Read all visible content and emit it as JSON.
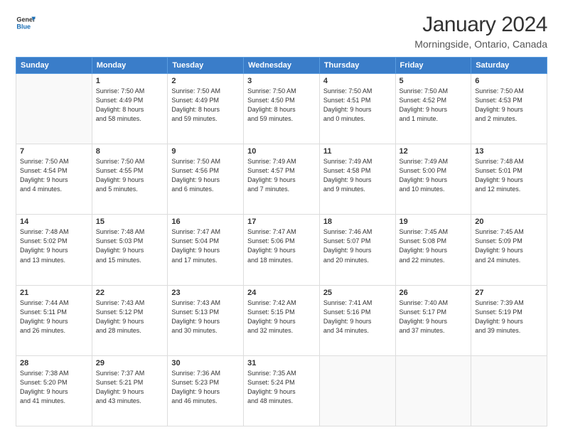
{
  "logo": {
    "line1": "General",
    "line2": "Blue"
  },
  "title": "January 2024",
  "subtitle": "Morningside, Ontario, Canada",
  "weekdays": [
    "Sunday",
    "Monday",
    "Tuesday",
    "Wednesday",
    "Thursday",
    "Friday",
    "Saturday"
  ],
  "weeks": [
    [
      {
        "day": "",
        "info": ""
      },
      {
        "day": "1",
        "info": "Sunrise: 7:50 AM\nSunset: 4:49 PM\nDaylight: 8 hours\nand 58 minutes."
      },
      {
        "day": "2",
        "info": "Sunrise: 7:50 AM\nSunset: 4:49 PM\nDaylight: 8 hours\nand 59 minutes."
      },
      {
        "day": "3",
        "info": "Sunrise: 7:50 AM\nSunset: 4:50 PM\nDaylight: 8 hours\nand 59 minutes."
      },
      {
        "day": "4",
        "info": "Sunrise: 7:50 AM\nSunset: 4:51 PM\nDaylight: 9 hours\nand 0 minutes."
      },
      {
        "day": "5",
        "info": "Sunrise: 7:50 AM\nSunset: 4:52 PM\nDaylight: 9 hours\nand 1 minute."
      },
      {
        "day": "6",
        "info": "Sunrise: 7:50 AM\nSunset: 4:53 PM\nDaylight: 9 hours\nand 2 minutes."
      }
    ],
    [
      {
        "day": "7",
        "info": "Sunrise: 7:50 AM\nSunset: 4:54 PM\nDaylight: 9 hours\nand 4 minutes."
      },
      {
        "day": "8",
        "info": "Sunrise: 7:50 AM\nSunset: 4:55 PM\nDaylight: 9 hours\nand 5 minutes."
      },
      {
        "day": "9",
        "info": "Sunrise: 7:50 AM\nSunset: 4:56 PM\nDaylight: 9 hours\nand 6 minutes."
      },
      {
        "day": "10",
        "info": "Sunrise: 7:49 AM\nSunset: 4:57 PM\nDaylight: 9 hours\nand 7 minutes."
      },
      {
        "day": "11",
        "info": "Sunrise: 7:49 AM\nSunset: 4:58 PM\nDaylight: 9 hours\nand 9 minutes."
      },
      {
        "day": "12",
        "info": "Sunrise: 7:49 AM\nSunset: 5:00 PM\nDaylight: 9 hours\nand 10 minutes."
      },
      {
        "day": "13",
        "info": "Sunrise: 7:48 AM\nSunset: 5:01 PM\nDaylight: 9 hours\nand 12 minutes."
      }
    ],
    [
      {
        "day": "14",
        "info": "Sunrise: 7:48 AM\nSunset: 5:02 PM\nDaylight: 9 hours\nand 13 minutes."
      },
      {
        "day": "15",
        "info": "Sunrise: 7:48 AM\nSunset: 5:03 PM\nDaylight: 9 hours\nand 15 minutes."
      },
      {
        "day": "16",
        "info": "Sunrise: 7:47 AM\nSunset: 5:04 PM\nDaylight: 9 hours\nand 17 minutes."
      },
      {
        "day": "17",
        "info": "Sunrise: 7:47 AM\nSunset: 5:06 PM\nDaylight: 9 hours\nand 18 minutes."
      },
      {
        "day": "18",
        "info": "Sunrise: 7:46 AM\nSunset: 5:07 PM\nDaylight: 9 hours\nand 20 minutes."
      },
      {
        "day": "19",
        "info": "Sunrise: 7:45 AM\nSunset: 5:08 PM\nDaylight: 9 hours\nand 22 minutes."
      },
      {
        "day": "20",
        "info": "Sunrise: 7:45 AM\nSunset: 5:09 PM\nDaylight: 9 hours\nand 24 minutes."
      }
    ],
    [
      {
        "day": "21",
        "info": "Sunrise: 7:44 AM\nSunset: 5:11 PM\nDaylight: 9 hours\nand 26 minutes."
      },
      {
        "day": "22",
        "info": "Sunrise: 7:43 AM\nSunset: 5:12 PM\nDaylight: 9 hours\nand 28 minutes."
      },
      {
        "day": "23",
        "info": "Sunrise: 7:43 AM\nSunset: 5:13 PM\nDaylight: 9 hours\nand 30 minutes."
      },
      {
        "day": "24",
        "info": "Sunrise: 7:42 AM\nSunset: 5:15 PM\nDaylight: 9 hours\nand 32 minutes."
      },
      {
        "day": "25",
        "info": "Sunrise: 7:41 AM\nSunset: 5:16 PM\nDaylight: 9 hours\nand 34 minutes."
      },
      {
        "day": "26",
        "info": "Sunrise: 7:40 AM\nSunset: 5:17 PM\nDaylight: 9 hours\nand 37 minutes."
      },
      {
        "day": "27",
        "info": "Sunrise: 7:39 AM\nSunset: 5:19 PM\nDaylight: 9 hours\nand 39 minutes."
      }
    ],
    [
      {
        "day": "28",
        "info": "Sunrise: 7:38 AM\nSunset: 5:20 PM\nDaylight: 9 hours\nand 41 minutes."
      },
      {
        "day": "29",
        "info": "Sunrise: 7:37 AM\nSunset: 5:21 PM\nDaylight: 9 hours\nand 43 minutes."
      },
      {
        "day": "30",
        "info": "Sunrise: 7:36 AM\nSunset: 5:23 PM\nDaylight: 9 hours\nand 46 minutes."
      },
      {
        "day": "31",
        "info": "Sunrise: 7:35 AM\nSunset: 5:24 PM\nDaylight: 9 hours\nand 48 minutes."
      },
      {
        "day": "",
        "info": ""
      },
      {
        "day": "",
        "info": ""
      },
      {
        "day": "",
        "info": ""
      }
    ]
  ]
}
